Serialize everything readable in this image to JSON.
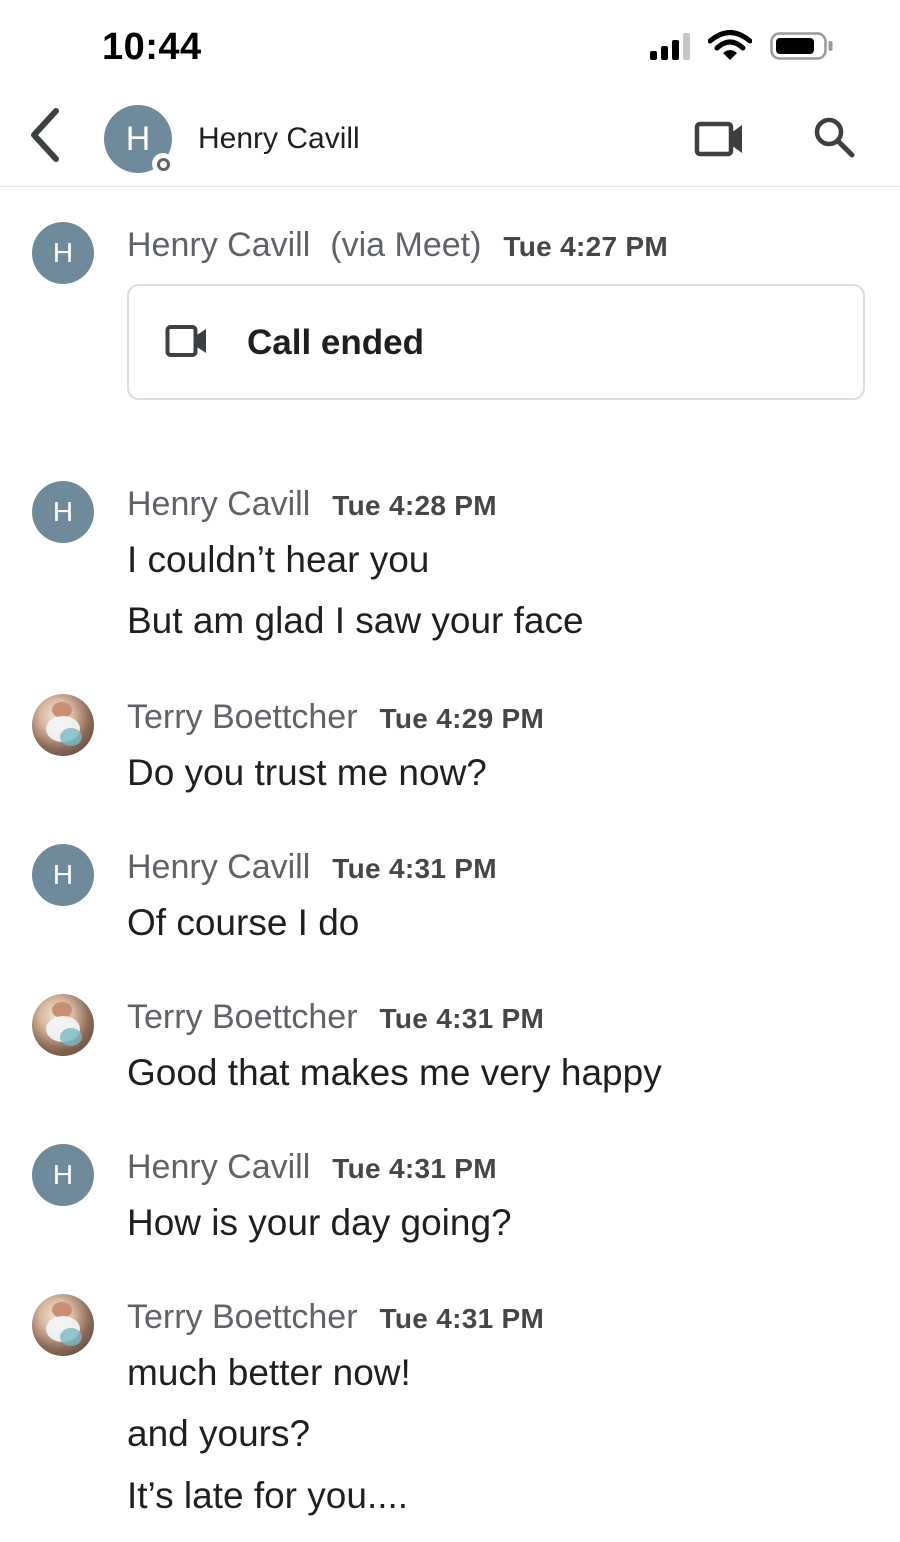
{
  "status_bar": {
    "time": "10:44"
  },
  "header": {
    "avatar_letter": "H",
    "contact_name": "Henry Cavill"
  },
  "call_event": {
    "avatar_letter": "H",
    "sender": "Henry Cavill",
    "via": "(via Meet)",
    "time": "Tue 4:27 PM",
    "label": "Call ended"
  },
  "messages": [
    {
      "sender": "Henry Cavill",
      "avatar": "H",
      "time": "Tue 4:28 PM",
      "lines": [
        "I couldn’t hear you",
        "But am glad I saw your face"
      ]
    },
    {
      "sender": "Terry Boettcher",
      "avatar": "photo",
      "time": "Tue 4:29 PM",
      "lines": [
        "Do you trust me now?"
      ]
    },
    {
      "sender": "Henry Cavill",
      "avatar": "H",
      "time": "Tue 4:31 PM",
      "lines": [
        "Of course I do"
      ]
    },
    {
      "sender": "Terry Boettcher",
      "avatar": "photo",
      "time": "Tue 4:31 PM",
      "lines": [
        "Good that makes me very happy"
      ]
    },
    {
      "sender": "Henry Cavill",
      "avatar": "H",
      "time": "Tue 4:31 PM",
      "lines": [
        "How is your day going?"
      ]
    },
    {
      "sender": "Terry Boettcher",
      "avatar": "photo",
      "time": "Tue 4:31 PM",
      "lines": [
        "much better now!",
        "and yours?",
        "It’s late for you...."
      ]
    }
  ],
  "icons": {
    "back": "chevron-left-icon",
    "video": "video-camera-icon",
    "search": "search-icon",
    "signal": "cellular-signal-icon",
    "wifi": "wifi-icon",
    "battery": "battery-icon"
  },
  "colors": {
    "avatar_bg": "#6f8a9a",
    "secondary_text": "#5f6368",
    "primary_text": "#1f1f1f",
    "divider": "#e3e3e3"
  }
}
